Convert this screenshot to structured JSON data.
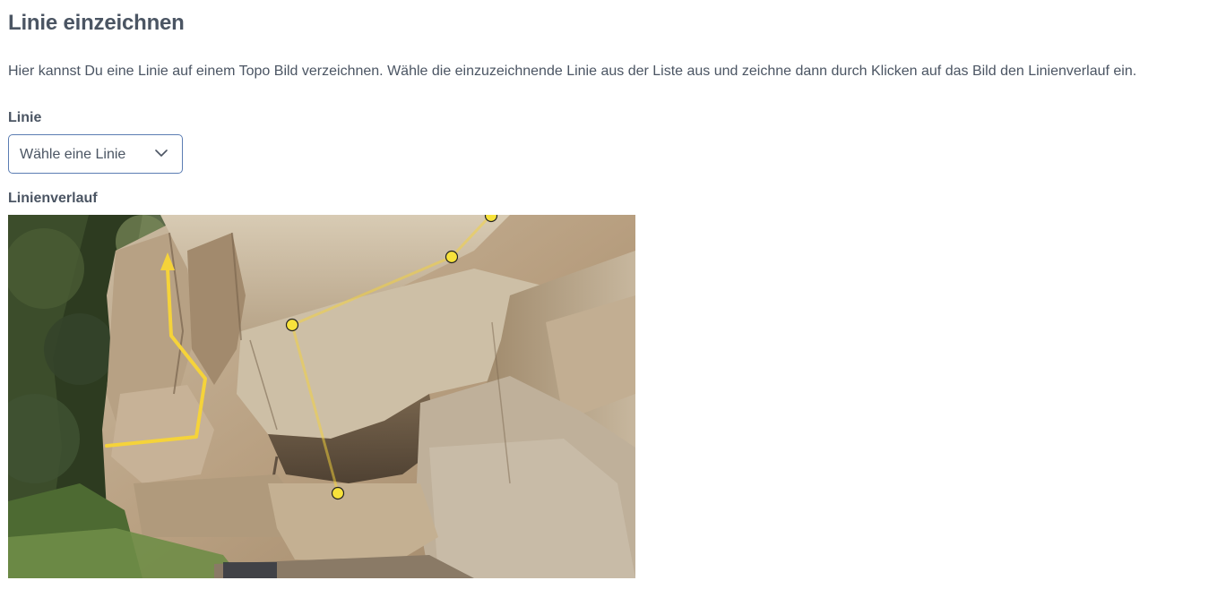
{
  "page": {
    "title": "Linie einzeichnen",
    "description": "Hier kannst Du eine Linie auf einem Topo Bild verzeichnen. Wähle die einzuzeichnende Linie aus der Liste aus und zeichne dann durch Klicken auf das Bild den Linienverlauf ein."
  },
  "line_select": {
    "label": "Linie",
    "value": "Wähle eine Linie",
    "icon": "chevron-down-icon"
  },
  "topo": {
    "label": "Linienverlauf",
    "line_color": "#f5d33a",
    "point_fill": "#f7e23b"
  }
}
